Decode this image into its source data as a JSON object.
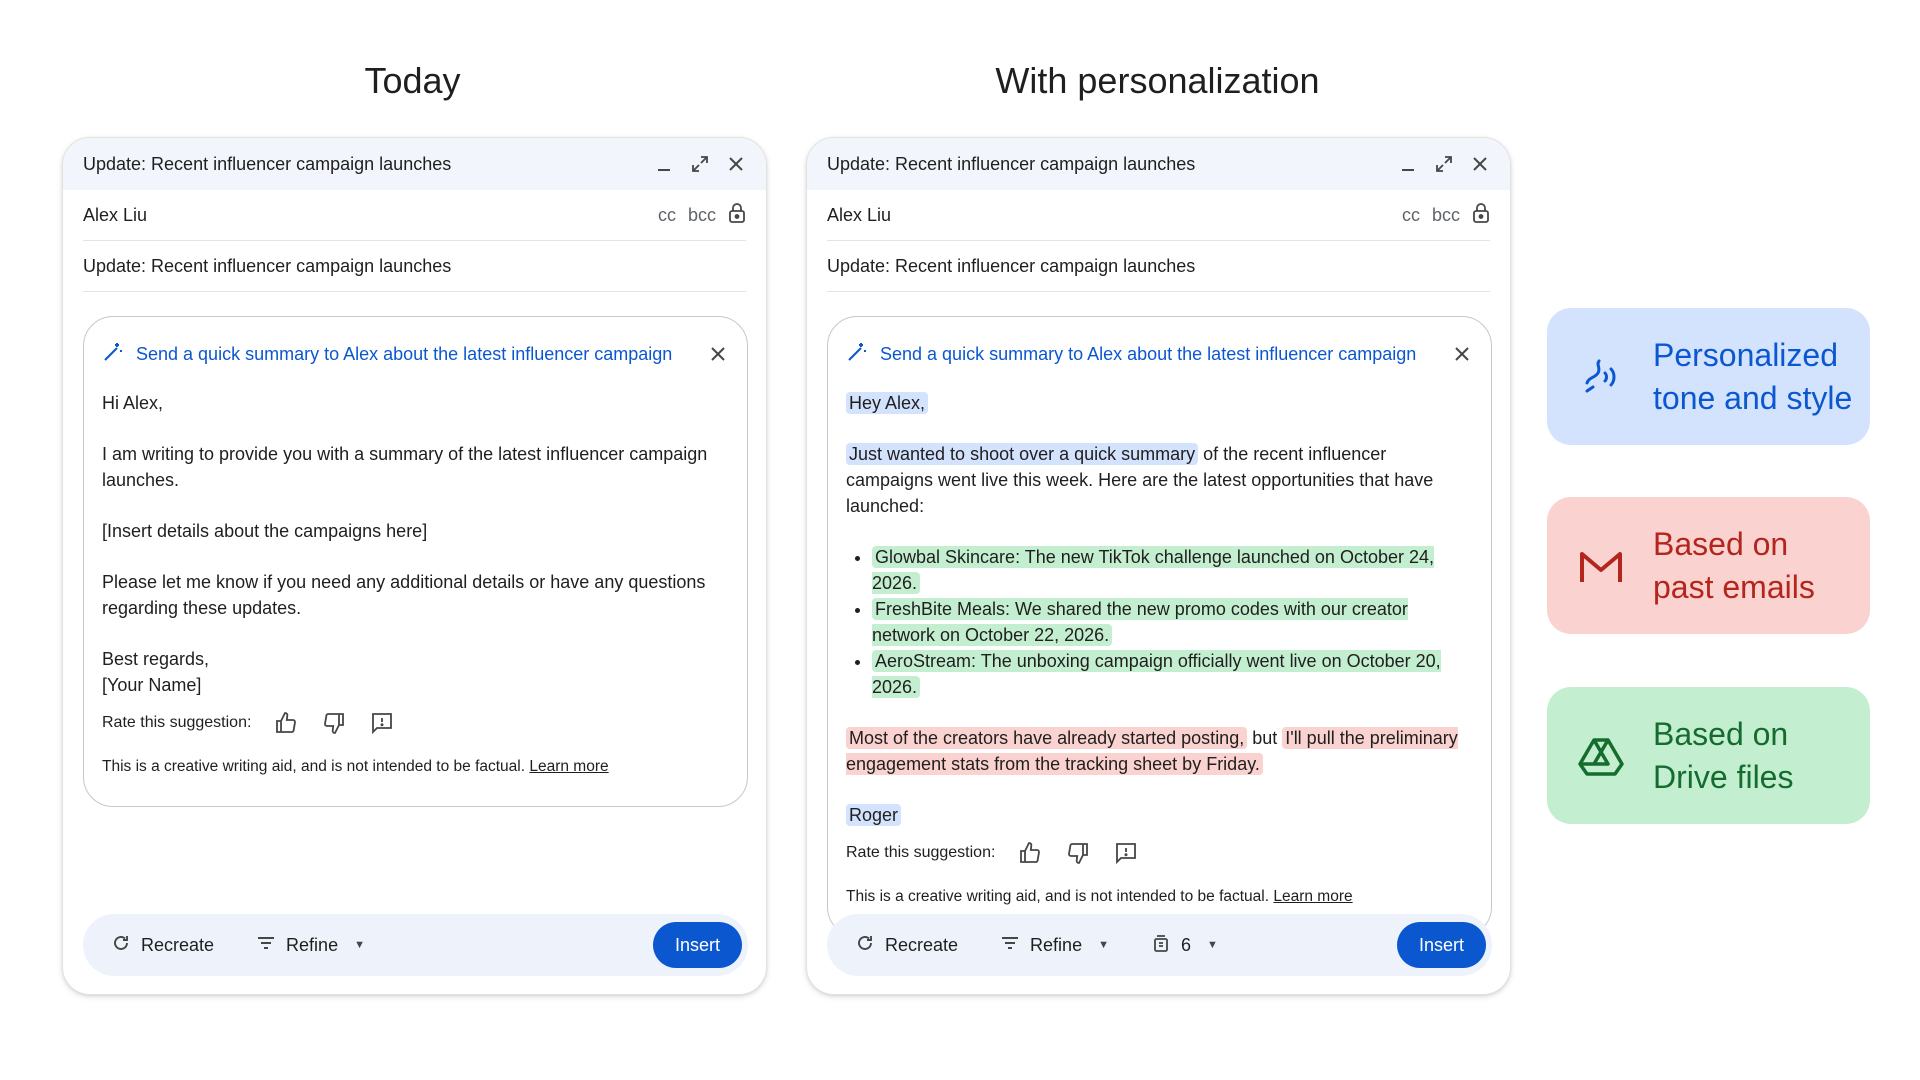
{
  "headings": {
    "left": "Today",
    "right": "With personalization"
  },
  "compose": {
    "title": "Update: Recent influencer campaign launches",
    "to": "Alex Liu",
    "cc": "cc",
    "bcc": "bcc",
    "subject": "Update: Recent influencer campaign launches",
    "prompt": "Send a quick summary to Alex about the latest influencer campaign",
    "rate_label": "Rate this suggestion:",
    "disclaimer": "This is a creative writing aid, and is not intended to be factual.",
    "learn_more": "Learn more",
    "recreate": "Recreate",
    "refine": "Refine",
    "insert": "Insert"
  },
  "today_body": {
    "greeting": "Hi Alex,",
    "p1": "I am writing to provide you with a summary of the latest influencer campaign launches.",
    "p2": "[Insert details about the campaigns here]",
    "p3": "Please let me know if you need any additional details or have any questions regarding these updates.",
    "signoff": "Best regards,",
    "name": "[Your Name]"
  },
  "personal_body": {
    "greeting": "Hey Alex,",
    "p1_hl": "Just wanted to shoot over a quick summary",
    "p1_rest": " of the recent influencer campaigns went live this week. Here are the latest opportunities that have launched:",
    "bullets": [
      "Glowbal Skincare: The new TikTok challenge launched on October 24, 2026.",
      "FreshBite Meals: We shared the new promo codes with our creator network on October 22, 2026.",
      "AeroStream: The unboxing campaign officially went live on October 20, 2026."
    ],
    "p2_hl1": "Most of the creators have already started posting,",
    "p2_mid": " but ",
    "p2_hl2": "I'll pull the preliminary engagement stats from the tracking sheet by Friday.",
    "name": "Roger",
    "sources_count": "6"
  },
  "features": [
    {
      "line1": "Personalized",
      "line2": "tone and style",
      "icon": "voice-icon",
      "color": "#0b57d0"
    },
    {
      "line1": "Based on",
      "line2": "past emails",
      "icon": "gmail-icon",
      "color": "#b3261e"
    },
    {
      "line1": "Based on",
      "line2": "Drive files",
      "icon": "drive-icon",
      "color": "#146c2e"
    }
  ]
}
